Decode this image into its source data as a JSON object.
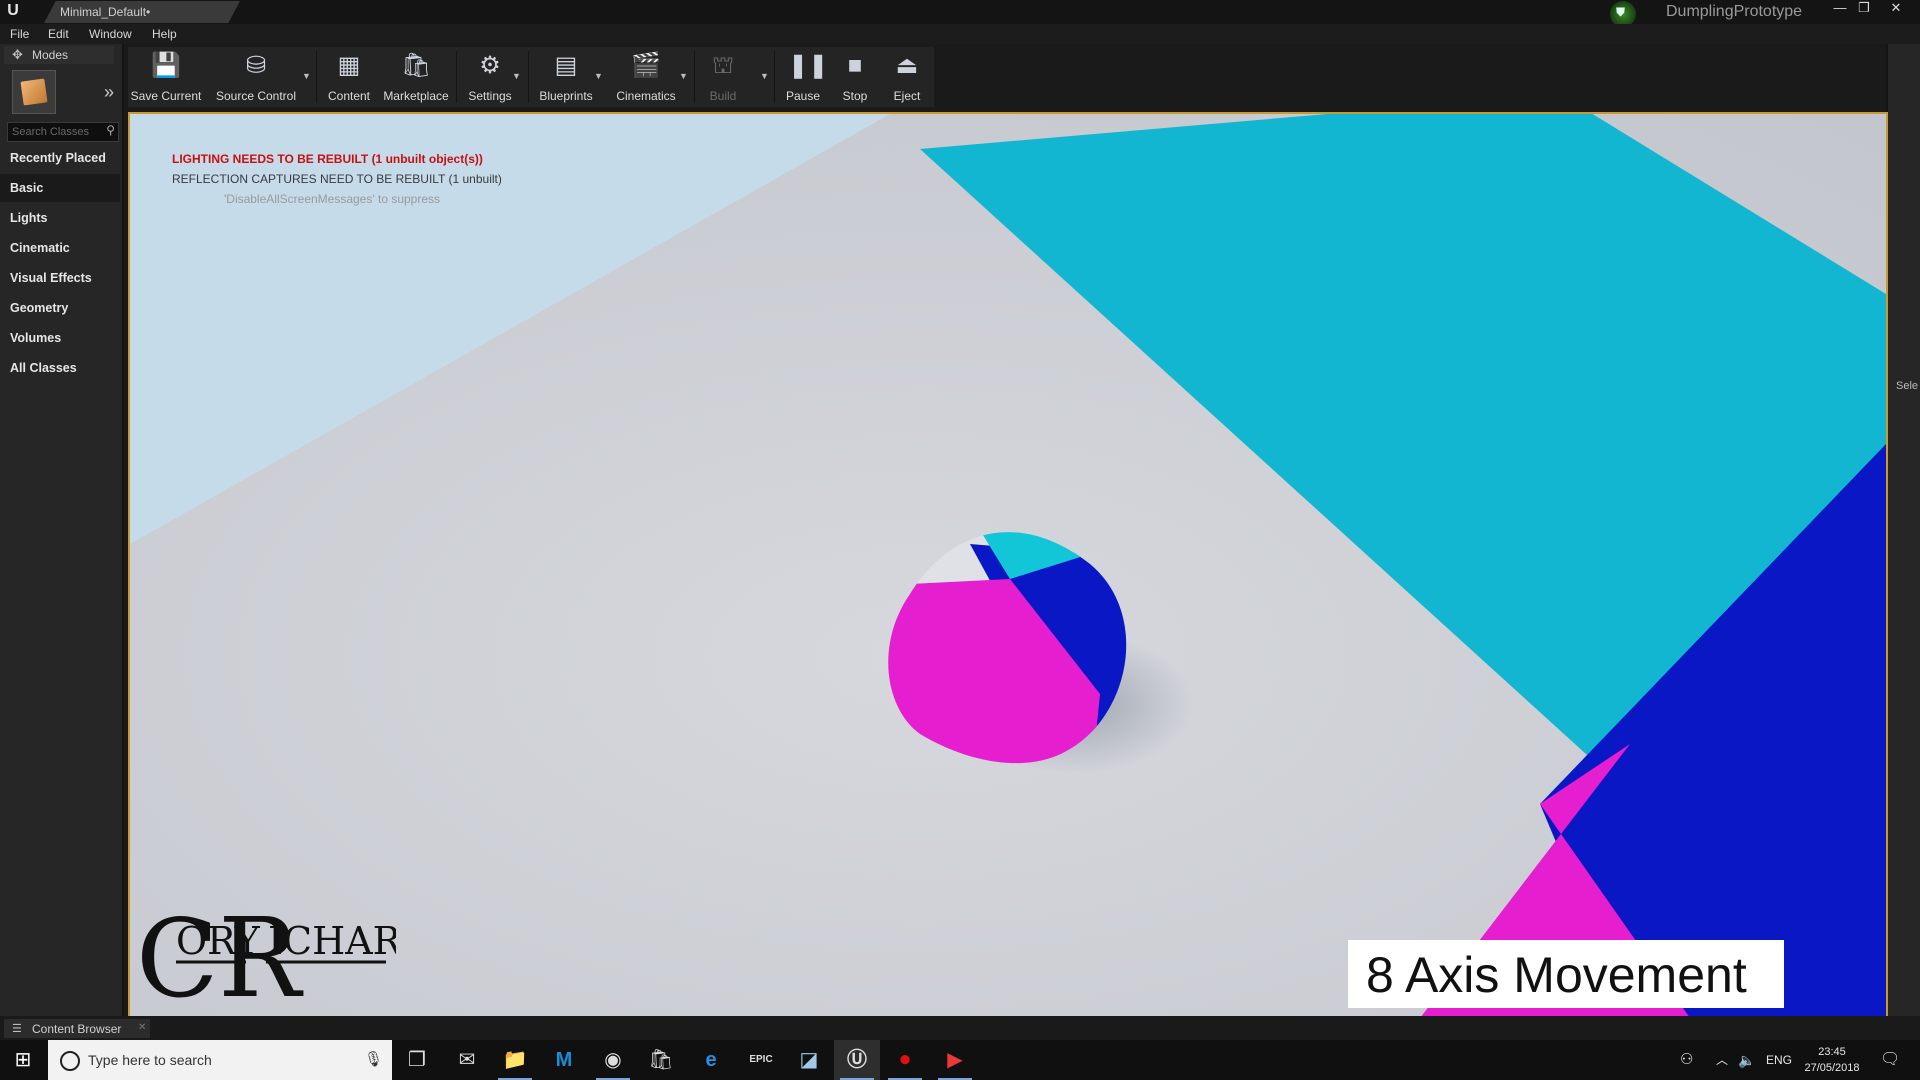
{
  "titlebar": {
    "logo": "U",
    "document_tab": "Minimal_Default•",
    "project_name": "DumplingPrototype",
    "project_icon": "project-badge-icon",
    "window_buttons": [
      "—",
      "❐",
      "✕"
    ]
  },
  "menu": {
    "items": [
      "File",
      "Edit",
      "Window",
      "Help"
    ]
  },
  "modes": {
    "tab_label": "Modes",
    "search_placeholder": "Search Classes",
    "categories": [
      "Recently Placed",
      "Basic",
      "Lights",
      "Cinematic",
      "Visual Effects",
      "Geometry",
      "Volumes",
      "All Classes"
    ],
    "selected_category": "Basic"
  },
  "toolbar": {
    "save_current": "Save Current",
    "source_control": "Source Control",
    "content": "Content",
    "marketplace": "Marketplace",
    "settings": "Settings",
    "blueprints": "Blueprints",
    "cinematics": "Cinematics",
    "build": "Build",
    "pause": "Pause",
    "stop": "Stop",
    "eject": "Eject"
  },
  "viewport": {
    "messages": {
      "lighting": "LIGHTING NEEDS TO BE REBUILT (1 unbuilt object(s))",
      "reflection": "REFLECTION CAPTURES NEED TO BE REBUILT (1 unbuilt)",
      "suppress": "'DisableAllScreenMessages' to suppress"
    },
    "signature": {
      "first": "ORY",
      "last": "ICHARDS",
      "initial_first": "C",
      "initial_last": "R"
    },
    "title_card": "8 Axis Movement",
    "colors": {
      "cyan": "#12b6d0",
      "blue": "#0a17c4",
      "magenta": "#e51fd0",
      "floor": "#d3d5da",
      "sky": "#c5dbea",
      "frame": "#c99a2e"
    }
  },
  "right_panel": {
    "label": "Sele"
  },
  "content_browser": {
    "tab_label": "Content Browser"
  },
  "taskbar": {
    "search_placeholder": "Type here to search",
    "apps": [
      "task-view-icon",
      "mail-icon",
      "file-explorer-icon",
      "malwarebytes-icon",
      "chrome-icon",
      "store-icon",
      "edge-icon",
      "epic-games-icon",
      "notes-icon",
      "unreal-engine-icon",
      "record-icon",
      "media-player-icon"
    ],
    "language": "ENG",
    "time": "23:45",
    "date": "27/05/2018"
  }
}
